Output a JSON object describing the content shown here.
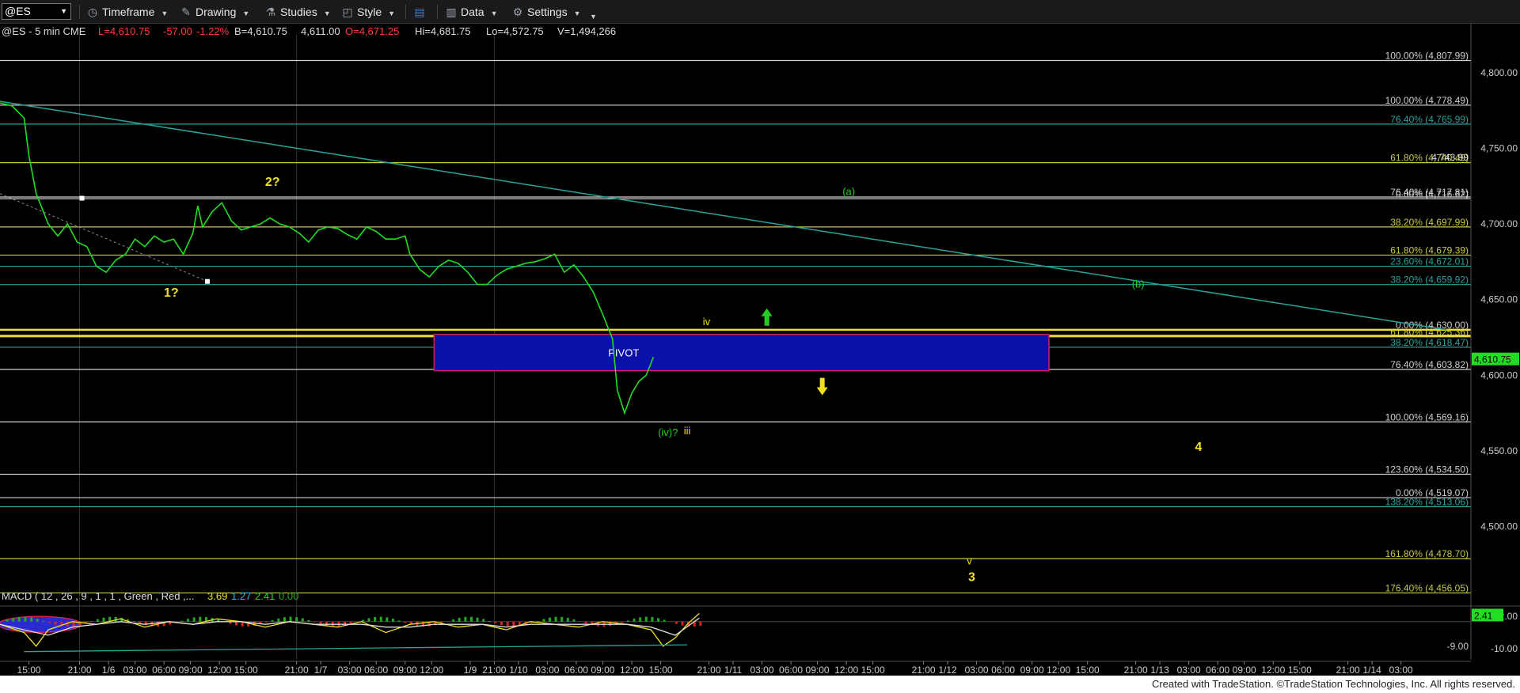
{
  "toolbar": {
    "symbol": "@ES",
    "items": [
      {
        "label": "Timeframe",
        "icon": "clock-icon"
      },
      {
        "label": "Drawing",
        "icon": "pencil-icon"
      },
      {
        "label": "Studies",
        "icon": "flask-icon"
      },
      {
        "label": "Style",
        "icon": "style-icon"
      },
      {
        "label": "",
        "icon": "layout-icon"
      },
      {
        "label": "Data",
        "icon": "data-bars-icon"
      },
      {
        "label": "Settings",
        "icon": "gear-icon"
      }
    ]
  },
  "header": {
    "symbol_info": "@ES - 5 min  CME",
    "last": "L=4,610.75",
    "change": "-57.00",
    "change_pct": "-1.22%",
    "bid": "B=4,610.75",
    "ask": "4,611.00",
    "open": "O=4,671.25",
    "high": "Hi=4,681.75",
    "low": "Lo=4,572.75",
    "volume": "V=1,494,266",
    "colors": {
      "neutral": "#dddddd",
      "down": "#ff3b3b"
    }
  },
  "footer": {
    "text": "Created with TradeStation. ©TradeStation Technologies, Inc. All rights reserved."
  },
  "chart_data": [
    {
      "type": "line",
      "title": "",
      "ylim": [
        4460,
        4825
      ],
      "xlim": [
        0,
        61
      ],
      "y_ticks": [
        "4,800.00",
        "4,750.00",
        "4,700.00",
        "4,650.00",
        "4,600.00",
        "4,550.00",
        "4,500.00"
      ],
      "y_tick_values": [
        4800,
        4750,
        4700,
        4650,
        4600,
        4550,
        4500
      ],
      "last_price": {
        "label": "4,610.75",
        "value": 4610.75
      },
      "extra_price_label": {
        "label": "4,743.99",
        "value": 4743.99
      },
      "x_ticks": [
        "15:00",
        "21:00",
        "1/6",
        "03:00",
        "06:00",
        "09:00",
        "12:00",
        "15:00",
        "21:00",
        "1/7",
        "03:00",
        "06:00",
        "09:00",
        "12:00",
        "1/9",
        "21:00",
        "1/10",
        "03:00",
        "06:00",
        "09:00",
        "12:00",
        "15:00",
        "21:00",
        "1/11",
        "03:00",
        "06:00",
        "09:00",
        "12:00",
        "15:00",
        "21:00",
        "1/12",
        "03:00",
        "06:00",
        "09:00",
        "12:00",
        "15:00",
        "21:00",
        "1/13",
        "03:00",
        "06:00",
        "09:00",
        "12:00",
        "15:00",
        "21:00",
        "1/14",
        "03:00"
      ],
      "x_tick_values": [
        1.2,
        3.3,
        4.5,
        5.6,
        6.8,
        7.9,
        9.1,
        10.2,
        12.3,
        13.3,
        14.5,
        15.6,
        16.8,
        17.9,
        19.5,
        20.5,
        21.5,
        22.7,
        23.9,
        25.0,
        26.2,
        27.4,
        29.4,
        30.4,
        31.6,
        32.8,
        33.9,
        35.1,
        36.2,
        38.3,
        39.3,
        40.5,
        41.6,
        42.8,
        43.9,
        45.1,
        47.1,
        48.1,
        49.3,
        50.5,
        51.6,
        52.8,
        53.9,
        55.9,
        56.9,
        58.1
      ],
      "series": [
        {
          "color": "#22dd22",
          "x": [
            0,
            0.5,
            1.0,
            1.2,
            1.5,
            2.0,
            2.4,
            2.8,
            3.2,
            3.6,
            4.0,
            4.4,
            4.8,
            5.2,
            5.6,
            6.0,
            6.4,
            6.8,
            7.2,
            7.6,
            8.0,
            8.2,
            8.4,
            8.8,
            9.2,
            9.6,
            10.0,
            10.4,
            10.8,
            11.2,
            11.6,
            12.0,
            12.4,
            12.8,
            13.2,
            13.6,
            14.0,
            14.4,
            14.8,
            15.2,
            15.6,
            16.0,
            16.4,
            16.8,
            17.0,
            17.4,
            17.8,
            18.2,
            18.6,
            19.0,
            19.4,
            19.8,
            20.2,
            20.6,
            21.0,
            21.4,
            21.8,
            22.2,
            22.6,
            23.0,
            23.4,
            23.8,
            24.2,
            24.6,
            25.0,
            25.4,
            25.6,
            25.9,
            26.2,
            26.5,
            26.8,
            27.1
          ],
          "y": [
            4780,
            4778,
            4770,
            4745,
            4720,
            4700,
            4692,
            4700,
            4688,
            4685,
            4672,
            4668,
            4676,
            4680,
            4690,
            4685,
            4692,
            4688,
            4690,
            4680,
            4694,
            4712,
            4698,
            4708,
            4714,
            4702,
            4696,
            4698,
            4700,
            4704,
            4700,
            4698,
            4694,
            4688,
            4696,
            4698,
            4697,
            4693,
            4690,
            4698,
            4695,
            4690,
            4690,
            4692,
            4680,
            4670,
            4665,
            4672,
            4676,
            4674,
            4668,
            4660,
            4660,
            4666,
            4670,
            4672,
            4674,
            4675,
            4677,
            4680,
            4668,
            4673,
            4665,
            4655,
            4640,
            4624,
            4590,
            4575,
            4588,
            4596,
            4600,
            4612
          ]
        }
      ],
      "horizontal_levels": [
        {
          "label": "100.00% (4,807.99)",
          "value": 4807.99,
          "color": "#cfcfcf"
        },
        {
          "label": "100.00% (4,778.49)",
          "value": 4778.49,
          "color": "#cfcfcf"
        },
        {
          "label": "76.40% (4,765.99)",
          "value": 4765.99,
          "color": "#2aa39a"
        },
        {
          "label": "61.80% (4,740.49)",
          "value": 4740.49,
          "color": "#c8c84a"
        },
        {
          "label": "76.40% (4,717.81)",
          "value": 4717.81,
          "color": "#cfcfcf"
        },
        {
          "label": "0.00% (4,716.62)",
          "value": 4716.62,
          "color": "#cfcfcf"
        },
        {
          "label": "38.20% (4,697.99)",
          "value": 4697.99,
          "color": "#c8c84a"
        },
        {
          "label": "61.80% (4,679.39)",
          "value": 4679.39,
          "color": "#c8c84a"
        },
        {
          "label": "23.60% (4,672.01)",
          "value": 4672.01,
          "color": "#2aa39a"
        },
        {
          "label": "38.20% (4,659.92)",
          "value": 4659.92,
          "color": "#2aa39a"
        },
        {
          "label": "0.00% (4,630.00)",
          "value": 4630.0,
          "color": "#cfcfcf"
        },
        {
          "label": "61.80% (4,625.36)",
          "value": 4625.36,
          "color": "#c8c84a"
        },
        {
          "label": "38.20% (4,618.47)",
          "value": 4618.47,
          "color": "#2aa39a"
        },
        {
          "label": "76.40% (4,603.82)",
          "value": 4603.82,
          "color": "#cfcfcf"
        },
        {
          "label": "100.00% (4,569.16)",
          "value": 4569.16,
          "color": "#cfcfcf"
        },
        {
          "label": "123.60% (4,534.50)",
          "value": 4534.5,
          "color": "#cfcfcf"
        },
        {
          "label": "0.00% (4,519.07)",
          "value": 4519.07,
          "color": "#cfcfcf"
        },
        {
          "label": "138.20% (4,513.06)",
          "value": 4513.06,
          "color": "#2aa39a"
        },
        {
          "label": "161.80% (4,478.70)",
          "value": 4478.7,
          "color": "#c8c84a"
        },
        {
          "label": "176.40% (4,456.05)",
          "value": 4456.05,
          "color": "#c8c84a"
        }
      ],
      "pivot_zone": {
        "label": "PIVOT",
        "y_low": 4603,
        "y_high": 4627,
        "x_start": 18.0,
        "x_end": 43.5,
        "fill": "#0a10a8",
        "border": "#cc2255"
      },
      "yellow_lines": [
        4630.0,
        4626.0
      ],
      "trendline": {
        "x": [
          0,
          60
        ],
        "y": [
          4781,
          4630
        ],
        "color": "#2aa39a"
      },
      "dashed_line": {
        "x": [
          0,
          8.6
        ],
        "y": [
          4720,
          4662
        ],
        "color": "#888888"
      },
      "markers": [
        {
          "x": 3.4,
          "y": 4717
        },
        {
          "x": 8.6,
          "y": 4662
        }
      ],
      "annotations": [
        {
          "text": "1?",
          "x": 7.1,
          "y": 4652,
          "color": "#f0e020",
          "bold": true
        },
        {
          "text": "2?",
          "x": 11.3,
          "y": 4725,
          "color": "#f0e020",
          "bold": true
        },
        {
          "text": "(a)",
          "x": 35.2,
          "y": 4719,
          "color": "#22cc22",
          "bold": false
        },
        {
          "text": "(b)",
          "x": 47.2,
          "y": 4658,
          "color": "#22cc22",
          "bold": false
        },
        {
          "text": "iv",
          "x": 29.3,
          "y": 4633,
          "color": "#f0e020",
          "bold": false
        },
        {
          "text": "(iv)?",
          "x": 27.7,
          "y": 4560,
          "color": "#22cc22",
          "bold": false
        },
        {
          "text": "iii",
          "x": 28.5,
          "y": 4561,
          "color": "#f0e020",
          "bold": false
        },
        {
          "text": "4",
          "x": 49.7,
          "y": 4550,
          "color": "#f0e020",
          "bold": true
        },
        {
          "text": "v",
          "x": 40.2,
          "y": 4475,
          "color": "#f0e020",
          "bold": false
        },
        {
          "text": "3",
          "x": 40.3,
          "y": 4464,
          "color": "#f0e020",
          "bold": true
        }
      ],
      "arrows": [
        {
          "direction": "up",
          "x": 31.8,
          "y": 4639,
          "color": "#22cc22"
        },
        {
          "direction": "down",
          "x": 34.1,
          "y": 4592,
          "color": "#f0e020"
        }
      ]
    },
    {
      "type": "line",
      "title": "MACD ( 12 , 26 , 9 , 1 , 1 , Green , Red ,...",
      "legend_values": [
        {
          "text": "3.69",
          "color": "#f0e020"
        },
        {
          "text": "1.27",
          "color": "#22bbee"
        },
        {
          "text": "2.41",
          "color": "#22dd22"
        },
        {
          "text": "0.00",
          "color": "#22aa22"
        }
      ],
      "ylim": [
        -14,
        4
      ],
      "y_ticks": [
        "2.00",
        "-10.00"
      ],
      "y_tick_values": [
        2,
        -10
      ],
      "last_value": {
        "label": "2.41",
        "value": 2.41
      },
      "extra_label": {
        "label": "-9.00",
        "value": -9
      },
      "series": [
        {
          "name": "MACD",
          "color": "#f0e020",
          "x": [
            0,
            1,
            1.5,
            2,
            3,
            4,
            5,
            6,
            7,
            8,
            9,
            10,
            11,
            12,
            13,
            14,
            15,
            16,
            17,
            18,
            19,
            20,
            21,
            22,
            23,
            24,
            25,
            26,
            27,
            27.5,
            28,
            28.5,
            29
          ],
          "y": [
            -1,
            -4,
            -9,
            -3,
            0,
            -1,
            1,
            -2,
            0,
            -1,
            1,
            0,
            -2,
            0,
            -1,
            -2,
            0,
            -4,
            -1,
            0,
            -2,
            -1,
            -3,
            0,
            -1,
            -2,
            0,
            -1,
            -3,
            -9,
            -6,
            -1,
            3
          ]
        },
        {
          "name": "Signal",
          "color": "#dddddd",
          "x": [
            0,
            1,
            2,
            3,
            4,
            5,
            6,
            7,
            8,
            9,
            10,
            11,
            12,
            13,
            14,
            15,
            16,
            17,
            18,
            19,
            20,
            21,
            22,
            23,
            24,
            25,
            26,
            27,
            28,
            29
          ],
          "y": [
            -1,
            -3,
            -5,
            -2,
            -1,
            0,
            -1,
            0,
            -1,
            0,
            0,
            -1,
            0,
            -1,
            -1,
            -1,
            -2,
            -2,
            -1,
            -1,
            -1,
            -2,
            -1,
            -1,
            -1,
            -1,
            -1,
            -2,
            -5,
            1.3
          ]
        },
        {
          "name": "Trend",
          "color": "#2aa39a",
          "x": [
            1,
            28.5
          ],
          "y": [
            -11,
            -8.5
          ]
        }
      ]
    }
  ]
}
